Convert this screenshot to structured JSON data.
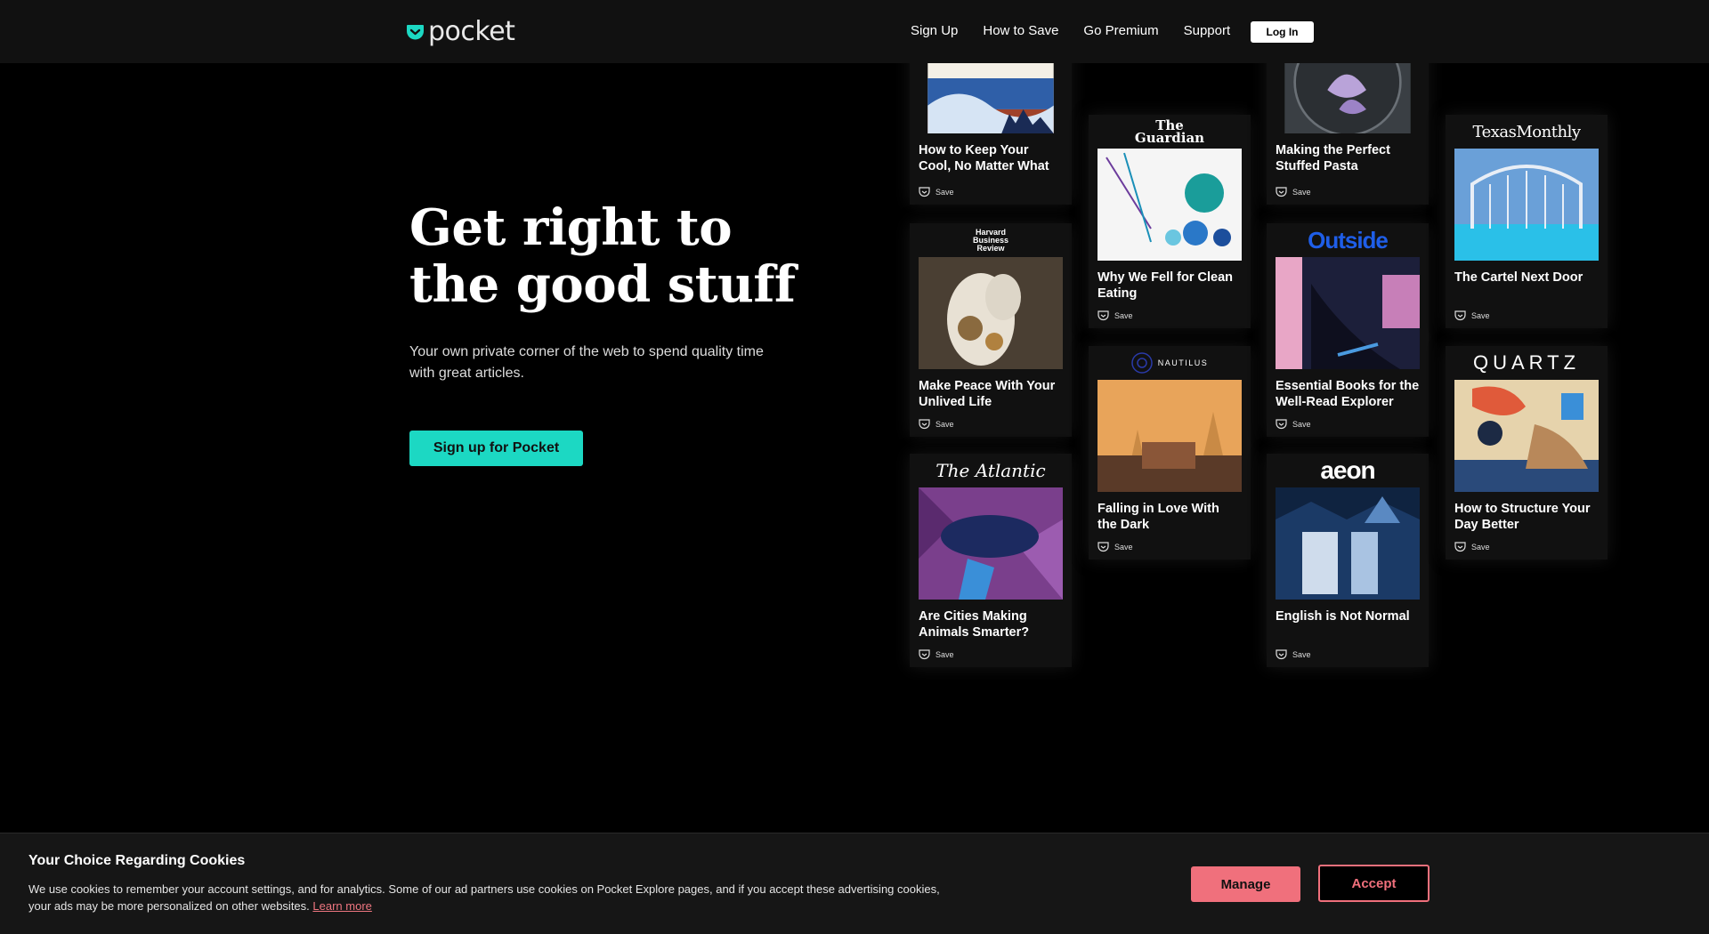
{
  "brand": {
    "name": "pocket",
    "accent": "#1cd8c3",
    "cookie_accent": "#f0707c"
  },
  "nav": {
    "items": [
      "Sign Up",
      "How to Save",
      "Go Premium",
      "Support"
    ],
    "login": "Log In"
  },
  "hero": {
    "title": "Get right to the good stuff",
    "subtitle": "Your own private corner of the web to spend quality time with great articles.",
    "cta": "Sign up for Pocket"
  },
  "cards": [
    {
      "publisher": "",
      "title": "How to Keep Your Cool, No Matter What",
      "save": "Save"
    },
    {
      "publisher": "Harvard Business Review",
      "title": "Make Peace With Your Unlived Life",
      "save": "Save"
    },
    {
      "publisher": "The Atlantic",
      "title": "Are Cities Making Animals Smarter?",
      "save": "Save"
    },
    {
      "publisher": "The Guardian",
      "title": "Why We Fell for Clean Eating",
      "save": "Save"
    },
    {
      "publisher": "NAUTILUS",
      "title": "Falling in Love With the Dark",
      "save": "Save"
    },
    {
      "publisher": "",
      "title": "Making the Perfect Stuffed Pasta",
      "save": "Save"
    },
    {
      "publisher": "Outside",
      "title": "Essential Books for the Well-Read Explorer",
      "save": "Save"
    },
    {
      "publisher": "aeon",
      "title": "English is Not Normal",
      "save": "Save"
    },
    {
      "publisher": "TexasMonthly",
      "title": "The Cartel Next Door",
      "save": "Save"
    },
    {
      "publisher": "QUARTZ",
      "title": "How to Structure Your Day Better",
      "save": "Save"
    }
  ],
  "cookie": {
    "title": "Your Choice Regarding Cookies",
    "text": "We use cookies to remember your account settings, and for analytics. Some of our ad partners use cookies on Pocket Explore pages, and if you accept these advertising cookies, your ads may be more personalized on other websites.",
    "learn_more": "Learn more",
    "manage": "Manage",
    "accept": "Accept"
  }
}
